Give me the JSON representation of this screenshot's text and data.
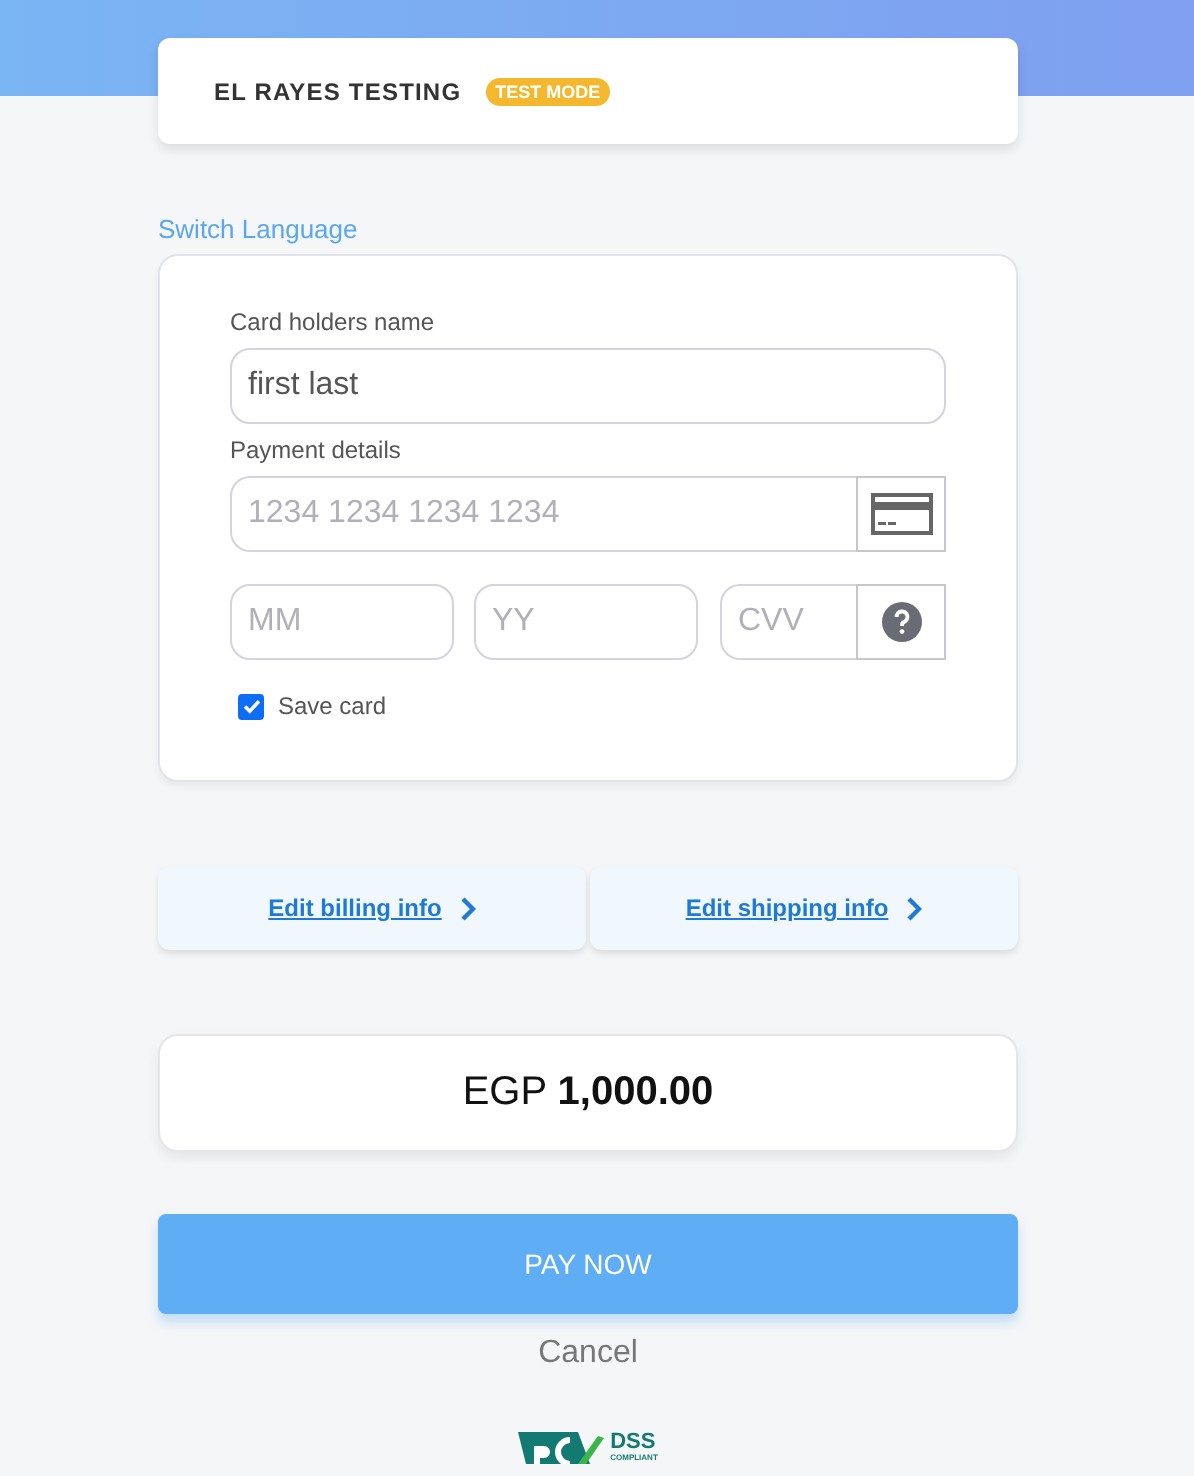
{
  "merchant": {
    "name": "EL RAYES TESTING",
    "badge": "TEST MODE"
  },
  "switch_language": "Switch Language",
  "form": {
    "name_label": "Card holders name",
    "name_field": {
      "value": "first last"
    },
    "payment_label": "Payment details",
    "card_number": {
      "placeholder": "1234 1234 1234 1234"
    },
    "expiry_month": {
      "placeholder": "MM"
    },
    "expiry_year": {
      "placeholder": "YY"
    },
    "cvv": {
      "placeholder": "CVV"
    },
    "save_card": {
      "label": "Save card",
      "checked": true
    }
  },
  "links": [
    {
      "label": "Edit billing info"
    },
    {
      "label": "Edit shipping info"
    }
  ],
  "amount": {
    "currency": "EGP",
    "value": "1,000.00"
  },
  "pay_button": "PAY NOW",
  "cancel": "Cancel",
  "footer_logo": {
    "text": "DSS",
    "subtext": "COMPLIANT"
  }
}
